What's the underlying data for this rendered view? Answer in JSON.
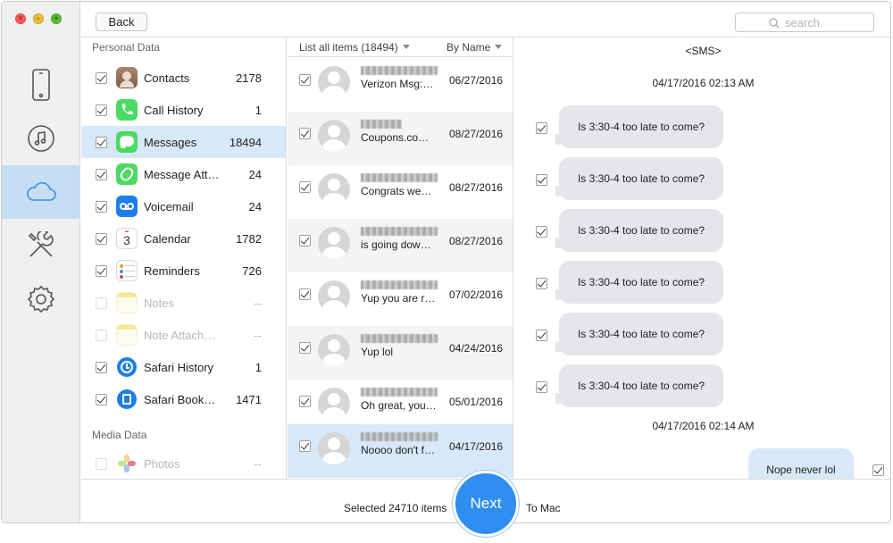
{
  "window": {
    "back_label": "Back",
    "search_placeholder": "search"
  },
  "rail": {
    "items": [
      {
        "icon": "phone-icon"
      },
      {
        "icon": "music-icon"
      },
      {
        "icon": "cloud-icon",
        "active": true
      },
      {
        "icon": "tools-icon"
      },
      {
        "icon": "gear-icon"
      }
    ]
  },
  "categories": {
    "personal_title": "Personal Data",
    "media_title": "Media Data",
    "items": [
      {
        "label": "Contacts",
        "count": "2178",
        "checked": true,
        "icon": "contacts-icon"
      },
      {
        "label": "Call History",
        "count": "1",
        "checked": true,
        "icon": "phone-call-icon"
      },
      {
        "label": "Messages",
        "count": "18494",
        "checked": true,
        "icon": "messages-icon",
        "selected": true
      },
      {
        "label": "Message Att…",
        "count": "24",
        "checked": true,
        "icon": "attachment-icon"
      },
      {
        "label": "Voicemail",
        "count": "24",
        "checked": true,
        "icon": "voicemail-icon"
      },
      {
        "label": "Calendar",
        "count": "1782",
        "checked": true,
        "icon": "calendar-icon"
      },
      {
        "label": "Reminders",
        "count": "726",
        "checked": true,
        "icon": "reminders-icon"
      },
      {
        "label": "Notes",
        "count": "--",
        "checked": false,
        "icon": "notes-icon",
        "disabled": true
      },
      {
        "label": "Note Attach…",
        "count": "--",
        "checked": false,
        "icon": "note-attachment-icon",
        "disabled": true
      },
      {
        "label": "Safari History",
        "count": "1",
        "checked": true,
        "icon": "safari-history-icon"
      },
      {
        "label": "Safari Book…",
        "count": "1471",
        "checked": true,
        "icon": "safari-bookmark-icon"
      }
    ],
    "media_items": [
      {
        "label": "Photos",
        "count": "--",
        "checked": false,
        "icon": "photos-icon",
        "disabled": true
      }
    ]
  },
  "list": {
    "header_left": "List all items (18494)",
    "header_right": "By Name",
    "rows": [
      {
        "snippet": "Verizon Msg:…",
        "date": "06/27/2016"
      },
      {
        "snippet": "Coupons.co…",
        "date": "08/27/2016"
      },
      {
        "snippet": "Congrats we…",
        "date": "08/27/2016"
      },
      {
        "snippet": " is going dow…",
        "date": "08/27/2016"
      },
      {
        "snippet": "Yup you are r…",
        "date": "07/02/2016"
      },
      {
        "snippet": "Yup lol",
        "date": "04/24/2016"
      },
      {
        "snippet": "Oh great, you…",
        "date": "05/01/2016"
      },
      {
        "snippet": "Noooo don't f…",
        "date": "04/17/2016",
        "selected": true
      }
    ]
  },
  "conversation": {
    "title": "<SMS>",
    "stamp1": "04/17/2016 02:13 AM",
    "messages": [
      "Is 3:30-4 too late to come?",
      "Is 3:30-4 too late to come?",
      "Is 3:30-4 too late to come?",
      "Is 3:30-4 too late to come?",
      "Is 3:30-4 too late to come?",
      "Is 3:30-4 too late to come?"
    ],
    "stamp2": "04/17/2016 02:14 AM",
    "outgoing": "Nope never lol"
  },
  "footer": {
    "selected_text": "Selected 24710 items",
    "next_label": "Next",
    "destination": "To Mac"
  },
  "colors": {
    "accent": "#2f8ef0",
    "selection": "#d7e8f8"
  }
}
